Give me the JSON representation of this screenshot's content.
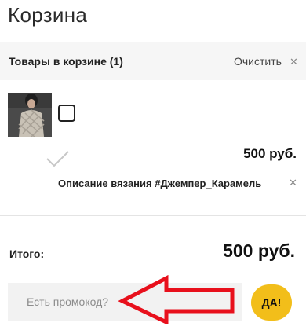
{
  "page": {
    "title": "Корзина"
  },
  "cart_header": {
    "title": "Товары в корзине (1)",
    "clear_label": "Очистить"
  },
  "cart_items": [
    {
      "name": "Описание вязания #Джемпер_Карамель",
      "price": "500 руб.",
      "image_icon": "sweater-photo",
      "checked": false
    }
  ],
  "summary": {
    "total_label": "Итого:",
    "total_value": "500 руб."
  },
  "promo": {
    "placeholder": "Есть промокод?",
    "value": "",
    "submit_label": "ДА!"
  },
  "colors": {
    "accent": "#f2be1a",
    "annotation": "#e8101c",
    "header_bg": "#f6f6f6",
    "promo_bg": "#f2f2f2"
  }
}
